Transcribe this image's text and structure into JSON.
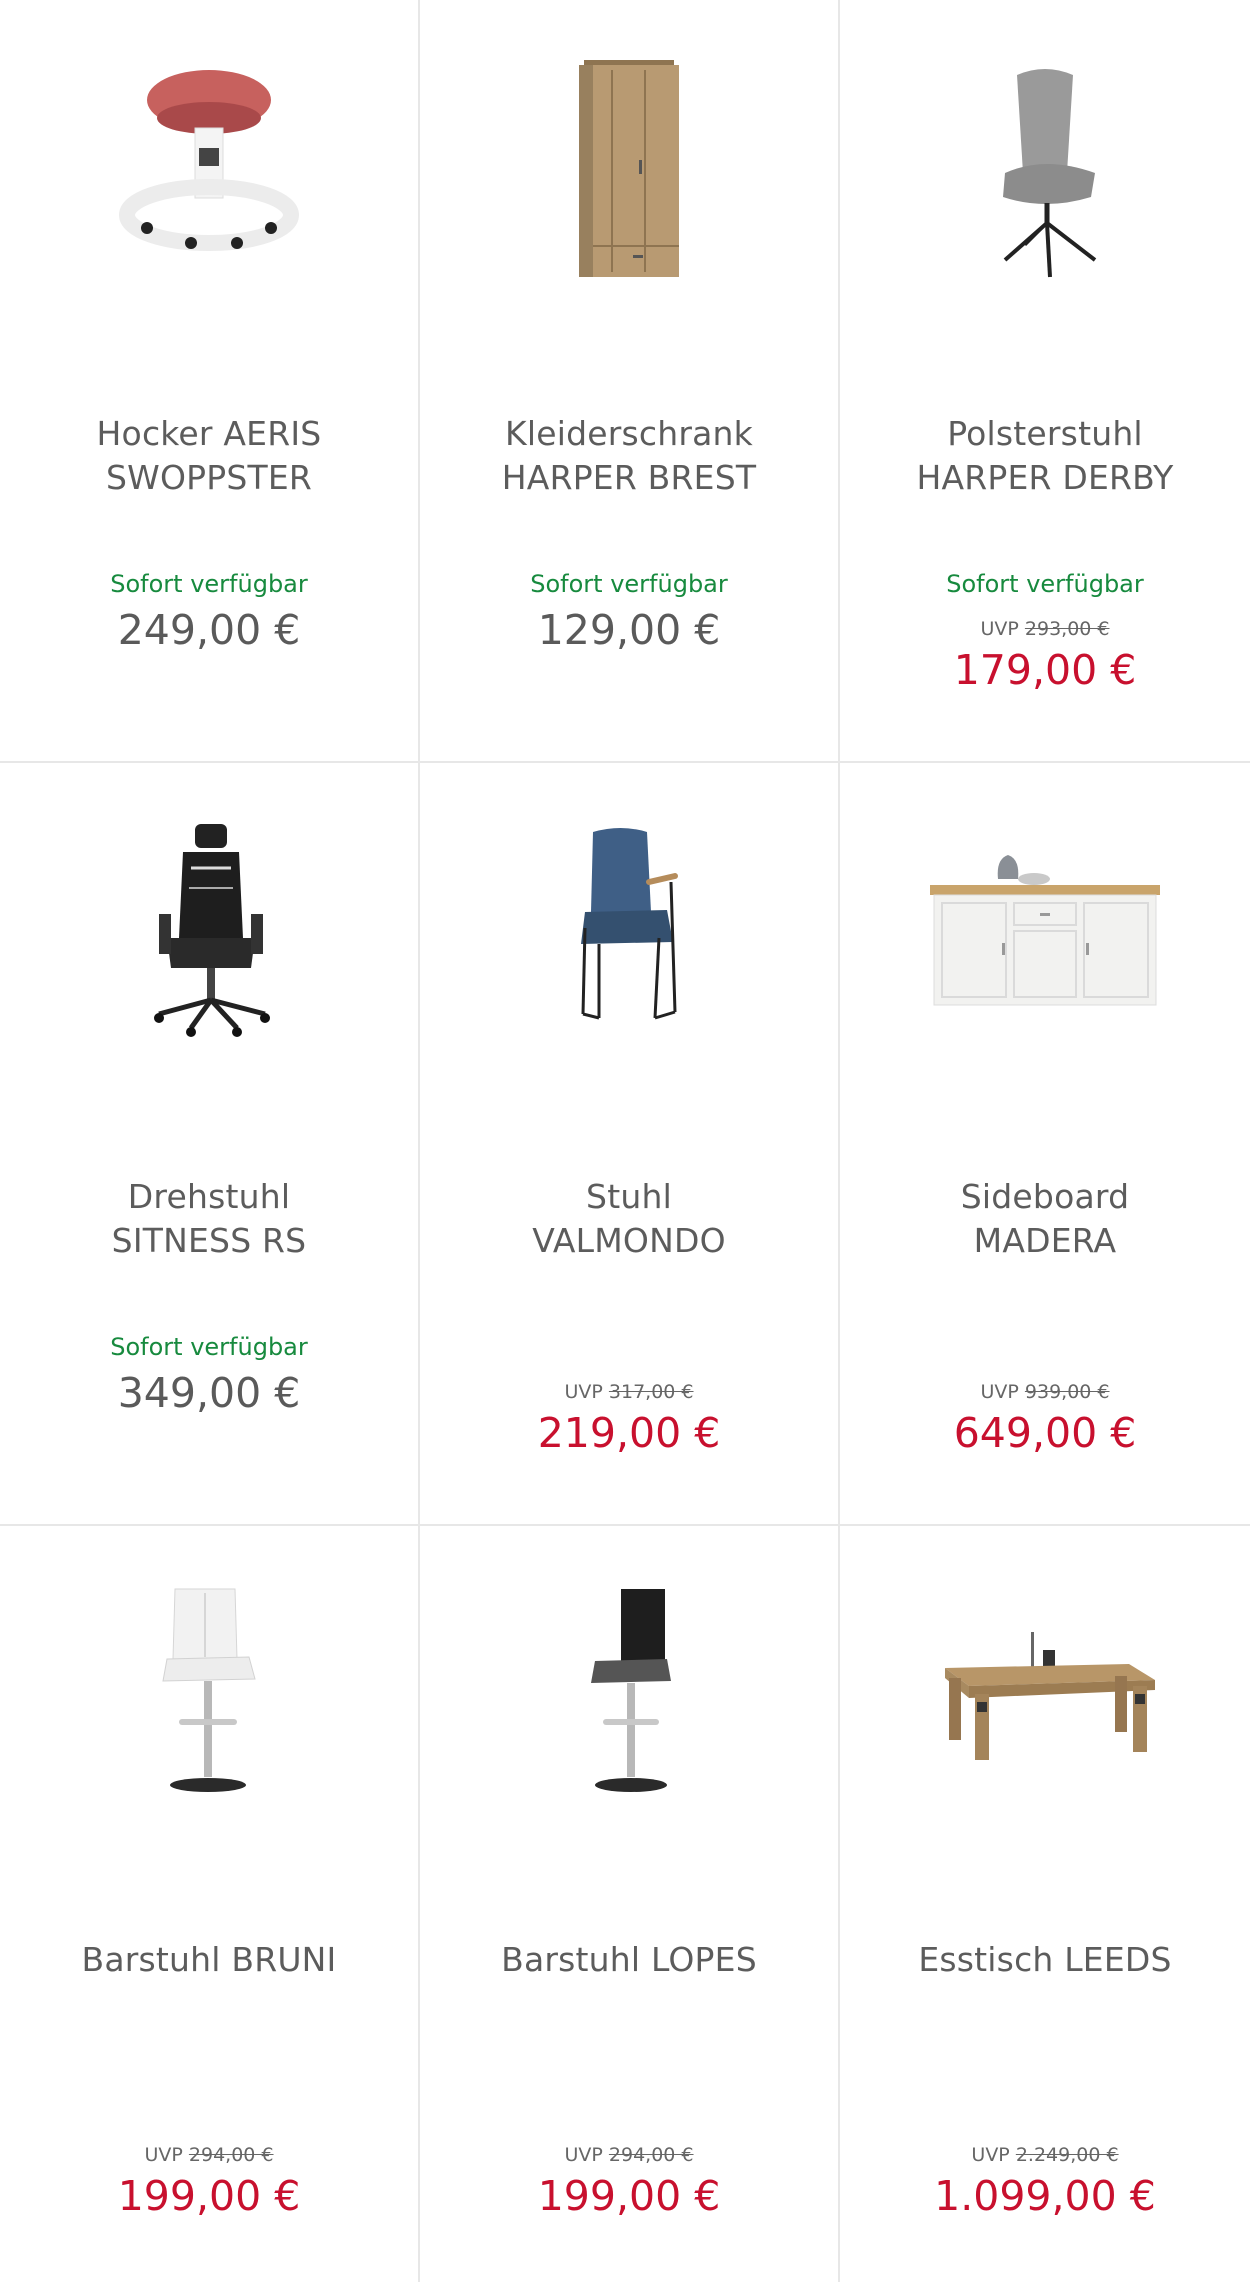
{
  "products": [
    {
      "title_line1": "Hocker AERIS",
      "title_line2": "SWOPPSTER",
      "availability": "Sofort verfügbar",
      "uvp_label": "",
      "uvp_price": "",
      "price": "249,00 €",
      "sale": false,
      "image": "stool-icon"
    },
    {
      "title_line1": "Kleiderschrank",
      "title_line2": "HARPER BREST",
      "availability": "Sofort verfügbar",
      "uvp_label": "",
      "uvp_price": "",
      "price": "129,00 €",
      "sale": false,
      "image": "wardrobe-icon"
    },
    {
      "title_line1": "Polsterstuhl",
      "title_line2": "HARPER DERBY",
      "availability": "Sofort verfügbar",
      "uvp_label": "UVP",
      "uvp_price": "293,00 €",
      "price": "179,00 €",
      "sale": true,
      "image": "upholstered-chair-icon"
    },
    {
      "title_line1": "Drehstuhl",
      "title_line2": "SITNESS RS",
      "availability": "Sofort verfügbar",
      "uvp_label": "",
      "uvp_price": "",
      "price": "349,00 €",
      "sale": false,
      "image": "office-chair-icon"
    },
    {
      "title_line1": "Stuhl",
      "title_line2": "VALMONDO",
      "availability": "",
      "uvp_label": "UVP",
      "uvp_price": "317,00 €",
      "price": "219,00 €",
      "sale": true,
      "image": "chair-icon"
    },
    {
      "title_line1": "Sideboard",
      "title_line2": "MADERA",
      "availability": "",
      "uvp_label": "UVP",
      "uvp_price": "939,00 €",
      "price": "649,00 €",
      "sale": true,
      "image": "sideboard-icon"
    },
    {
      "title_line1": "Barstuhl BRUNI",
      "title_line2": "",
      "availability": "",
      "uvp_label": "UVP",
      "uvp_price": "294,00 €",
      "price": "199,00 €",
      "sale": true,
      "image": "bar-stool-white-icon"
    },
    {
      "title_line1": "Barstuhl LOPES",
      "title_line2": "",
      "availability": "",
      "uvp_label": "UVP",
      "uvp_price": "294,00 €",
      "price": "199,00 €",
      "sale": true,
      "image": "bar-stool-black-icon"
    },
    {
      "title_line1": "Esstisch LEEDS",
      "title_line2": "",
      "availability": "",
      "uvp_label": "UVP",
      "uvp_price": "2.249,00 €",
      "price": "1.099,00 €",
      "sale": true,
      "image": "dining-table-icon"
    }
  ],
  "colors": {
    "availability": "#178a3e",
    "sale_price": "#c8102e",
    "regular_price": "#5a5a5a",
    "divider": "#e7e7e7"
  }
}
